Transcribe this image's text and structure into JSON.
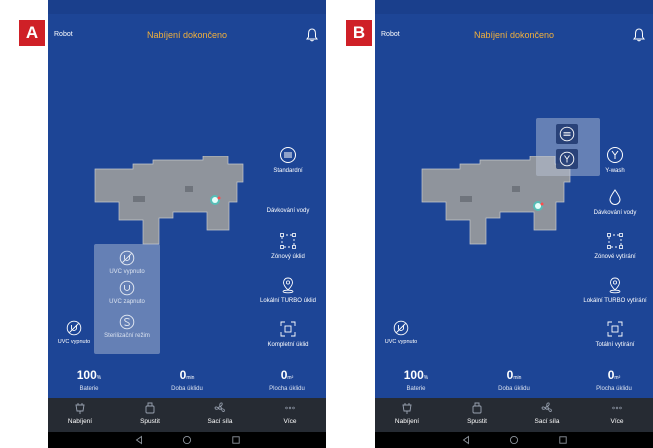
{
  "markers": {
    "a": "A",
    "b": "B"
  },
  "colors": {
    "panel_bg": "#1d4596",
    "title": "#f3b13b",
    "marker": "#cf2027",
    "nav_bg": "#262b33"
  },
  "panelA": {
    "header": {
      "left": "Robot",
      "title": "Nabíjení dokončeno",
      "bell_icon": "bell-icon"
    },
    "side_items": [
      {
        "label": "Standardní",
        "icon": "suction-mode-icon"
      },
      {
        "label": "Dávkování vody",
        "icon": ""
      },
      {
        "label": "Zónový úklid",
        "icon": "zone-icon"
      },
      {
        "label": "Lokální TURBO úklid",
        "icon": "location-pin-icon"
      },
      {
        "label": "Kompletní úklid",
        "icon": "full-clean-icon"
      }
    ],
    "uvc_popup": [
      {
        "label": "UVC vypnuto",
        "icon": "uvc-off-icon"
      },
      {
        "label": "UVC zapnuto",
        "icon": "uvc-on-icon"
      },
      {
        "label": "Sterilizační režim",
        "icon": "sterilize-icon"
      }
    ],
    "uvc_button": {
      "label": "UVC vypnuto",
      "icon": "uvc-off-icon"
    },
    "stats": [
      {
        "value": "100",
        "unit": "%",
        "label": "Baterie"
      },
      {
        "value": "0",
        "unit": "min",
        "label": "Doba úklidu"
      },
      {
        "value": "0",
        "unit": "m²",
        "label": "Plocha úklidu"
      }
    ],
    "nav": [
      {
        "label": "Nabíjení",
        "icon": "dock-icon"
      },
      {
        "label": "Spustit",
        "icon": "robot-icon"
      },
      {
        "label": "Sací síla",
        "icon": "fan-icon"
      },
      {
        "label": "Více",
        "icon": "more-icon"
      }
    ]
  },
  "panelB": {
    "header": {
      "left": "Robot",
      "title": "Nabíjení dokončeno",
      "bell_icon": "bell-icon"
    },
    "side_items": [
      {
        "label": "Y-wash",
        "icon": "y-wash-icon"
      },
      {
        "label": "Dávkování vody",
        "icon": "water-drop-icon"
      },
      {
        "label": "Zónové vytírání",
        "icon": "zone-icon"
      },
      {
        "label": "Lokální TURBO vytírání",
        "icon": "location-pin-icon"
      },
      {
        "label": "Totální vytírání",
        "icon": "full-clean-icon"
      }
    ],
    "mode_popup": [
      {
        "icon": "standard-mop-icon"
      },
      {
        "icon": "y-wash-icon"
      }
    ],
    "uvc_button": {
      "label": "UVC vypnuto",
      "icon": "uvc-off-icon"
    },
    "stats": [
      {
        "value": "100",
        "unit": "%",
        "label": "Baterie"
      },
      {
        "value": "0",
        "unit": "min",
        "label": "Doba úklidu"
      },
      {
        "value": "0",
        "unit": "m²",
        "label": "Plocha úklidu"
      }
    ],
    "nav": [
      {
        "label": "Nabíjení",
        "icon": "dock-icon"
      },
      {
        "label": "Spustit",
        "icon": "robot-icon"
      },
      {
        "label": "Sací síla",
        "icon": "fan-icon"
      },
      {
        "label": "Více",
        "icon": "more-icon"
      }
    ]
  }
}
